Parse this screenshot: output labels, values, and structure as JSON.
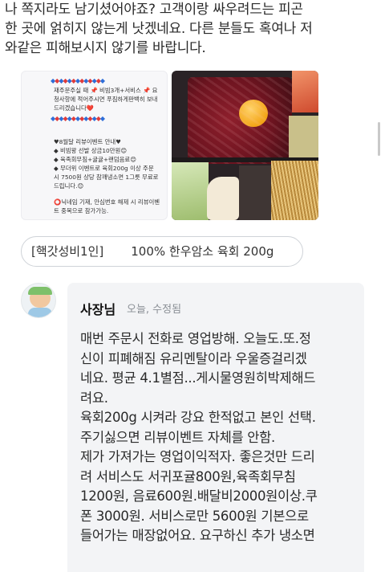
{
  "review": {
    "text": "나 쪽지라도 남기셨어야죠? 고객이랑 싸우려드는 피곤\n한 곳에 얽히지 않는게 낫겠네요. 다른 분들도 혹여나 저\n와같은 피해보시지 않기를 바랍니다."
  },
  "photo1": {
    "lines": [
      "재주문주실 때 📌 비빔3개+서비스 📌 요",
      "청사항에 적어주시면 푸짐하게판백히 보내",
      "드리겠습니다❤️",
      "♥8월달 리뷰이벤트 안내♥",
      "◆ 비빔왕 선발 상금10만원😊",
      "◆ 육족회무침+귤귤+랜덤음료😊",
      "◆ 무더위 이벤트로 육회200g 이상 주문",
      "시 7500원 상당 참깨냉소면 1그릇 무료로",
      "드립니다.😊",
      "⭕닉네임 기재, 안심번호 해제 시 리뷰이벤",
      "트 중복으로 참가가능."
    ]
  },
  "menu_tag": {
    "part1": "[핵갓성비1인]",
    "part2": "100% 한우암소 육회 200g"
  },
  "owner": {
    "name": "사장님",
    "meta": "오늘, 수정됨",
    "reply": "매번 주문시 전화로 영업방해. 오늘도.또.정\n신이 피폐해짐 유리멘탈이라 우울증걸리겠\n네요. 평균 4.1별점...게시물영원히박제해드\n려요.\n육회200g 시켜라 강요 한적없고 본인 선택.\n주기싫으면 리뷰이벤트 자체를 안함.\n제가 가져가는 영업이익적자. 좋은것만 드리\n려 서비스도 서귀포귤800원,육족회무침\n1200원, 음료600원.배달비2000원이상.쿠\n폰 3000원. 서비스로만 5600원 기본으로\n들어가는 매장없어요. 요구하신 추가 냉소면"
  },
  "colors": {
    "accent_blue": "#2f6ed8",
    "accent_red": "#e03b3b",
    "reply_bg": "#f3f4f6",
    "meta_gray": "#8a8f95"
  }
}
